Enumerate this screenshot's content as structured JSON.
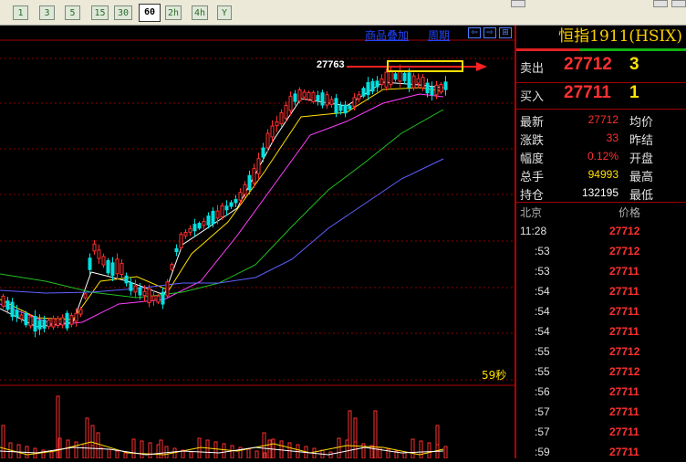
{
  "toolbar": {
    "periods": [
      "1",
      "3",
      "5",
      "15",
      "30",
      "60",
      "2h",
      "4h",
      "Y"
    ],
    "active_period": "60"
  },
  "chart_header": {
    "overlay_label": "商品叠加",
    "period_label": "周期"
  },
  "chart": {
    "max_price_label": "27763",
    "countdown": "59秒",
    "colors": {
      "up": "#ff3030",
      "down": "#00e0e0",
      "ma1": "#ffffff",
      "ma2": "#ffe000",
      "ma3": "#ff40ff",
      "ma4": "#20c020",
      "ma5": "#6060ff",
      "grid": "#8b0000"
    }
  },
  "instrument": {
    "title": "恒指1911(HSIX)"
  },
  "orderbook": {
    "ask": {
      "label": "卖出",
      "price": "27712",
      "volume": "3"
    },
    "bid": {
      "label": "买入",
      "price": "27711",
      "volume": "1"
    }
  },
  "quote": [
    {
      "label": "最新",
      "value": "27712",
      "color": "#ff3030",
      "right": "均价"
    },
    {
      "label": "涨跌",
      "value": "33",
      "color": "#ff3030",
      "right": "昨结"
    },
    {
      "label": "幅度",
      "value": "0.12%",
      "color": "#ff3030",
      "right": "开盘"
    },
    {
      "label": "总手",
      "value": "94993",
      "color": "#ffe000",
      "right": "最高"
    },
    {
      "label": "持仓",
      "value": "132195",
      "color": "#ffffff",
      "right": "最低"
    }
  ],
  "ticks": {
    "head_time": "北京",
    "head_price": "价格",
    "rows": [
      {
        "time": "11:28",
        "price": "27712"
      },
      {
        "time": ":53",
        "price": "27712"
      },
      {
        "time": ":53",
        "price": "27711"
      },
      {
        "time": ":54",
        "price": "27711"
      },
      {
        "time": ":54",
        "price": "27711"
      },
      {
        "time": ":54",
        "price": "27711"
      },
      {
        "time": ":55",
        "price": "27712"
      },
      {
        "time": ":55",
        "price": "27712"
      },
      {
        "time": ":56",
        "price": "27711"
      },
      {
        "time": ":57",
        "price": "27711"
      },
      {
        "time": ":57",
        "price": "27711"
      },
      {
        "time": ":59",
        "price": "27711"
      }
    ]
  }
}
